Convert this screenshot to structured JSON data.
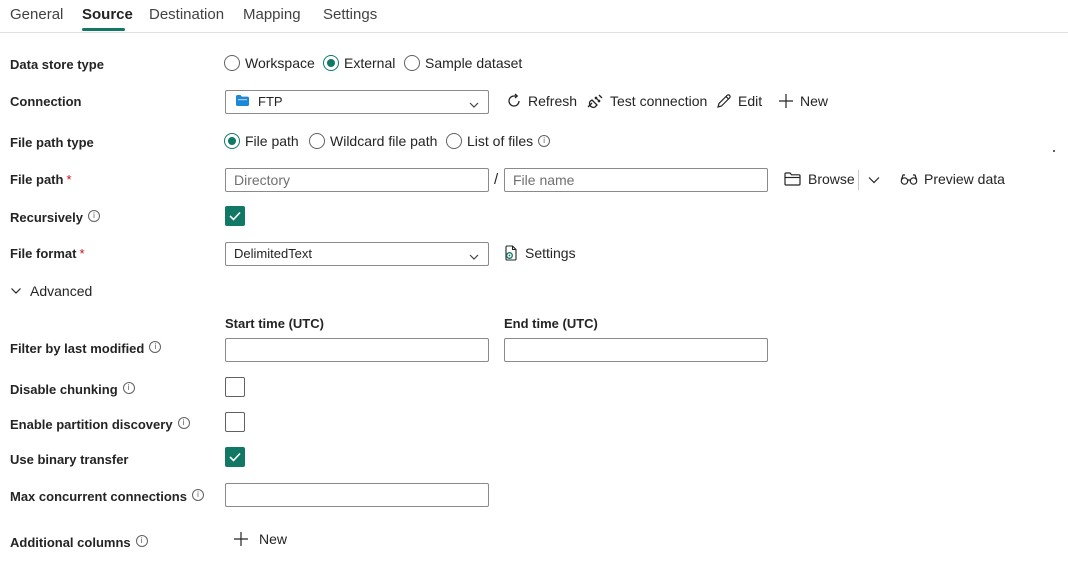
{
  "tabs": [
    {
      "label": "General",
      "active": false
    },
    {
      "label": "Source",
      "active": true
    },
    {
      "label": "Destination",
      "active": false
    },
    {
      "label": "Mapping",
      "active": false
    },
    {
      "label": "Settings",
      "active": false
    }
  ],
  "accent_color": "#117865",
  "data_store_type": {
    "label": "Data store type",
    "options": [
      "Workspace",
      "External",
      "Sample dataset"
    ],
    "selected": "External"
  },
  "connection": {
    "label": "Connection",
    "value": "FTP",
    "icon": "folder-icon",
    "actions": {
      "refresh": "Refresh",
      "test": "Test connection",
      "edit": "Edit",
      "new": "New"
    }
  },
  "file_path_type": {
    "label": "File path type",
    "options": [
      "File path",
      "Wildcard file path",
      "List of files"
    ],
    "selected": "File path"
  },
  "file_path": {
    "label": "File path",
    "directory_placeholder": "Directory",
    "separator": "/",
    "filename_placeholder": "File name",
    "browse": "Browse",
    "preview": "Preview data"
  },
  "recursively": {
    "label": "Recursively",
    "checked": true
  },
  "file_format": {
    "label": "File format",
    "value": "DelimitedText",
    "settings": "Settings"
  },
  "advanced": {
    "label": "Advanced",
    "expanded": true
  },
  "filter": {
    "label": "Filter by last modified",
    "start_header": "Start time (UTC)",
    "end_header": "End time (UTC)",
    "start_value": "",
    "end_value": ""
  },
  "disable_chunking": {
    "label": "Disable chunking",
    "checked": false
  },
  "partition_discovery": {
    "label": "Enable partition discovery",
    "checked": false
  },
  "binary_transfer": {
    "label": "Use binary transfer",
    "checked": true
  },
  "max_connections": {
    "label": "Max concurrent connections",
    "value": ""
  },
  "additional_columns": {
    "label": "Additional columns",
    "new": "New"
  }
}
